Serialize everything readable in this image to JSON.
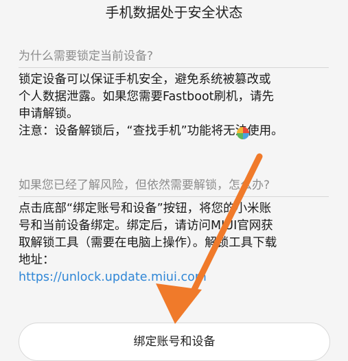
{
  "header": {
    "title": "手机数据处于安全状态"
  },
  "section1": {
    "question": "为什么需要锁定当前设备?",
    "lines": [
      "锁定设备可以保证手机安全，避免系统被篡改或",
      "个人数据泄露。如果您需要Fastboot刷机，请先",
      "申请解锁。",
      "注意：设备解锁后，“查找手机”功能将无法使用。"
    ]
  },
  "section2": {
    "question": "如果您已经了解风险，但依然需要解锁，怎么办?",
    "lines": [
      "点击底部“绑定账号和设备”按钮，将您的小米账",
      "号和当前设备绑定。绑定后，请访问MIUI官网获",
      "取解锁工具（需要在电脑上操作）。解锁工具下载",
      "地址："
    ],
    "link": "https://unlock.update.miui.com"
  },
  "bind_button_label": "绑定账号和设备",
  "annotation": {
    "arrow_color": "#f07a2a"
  },
  "icons": {
    "logo": "colorful-logo-icon"
  }
}
